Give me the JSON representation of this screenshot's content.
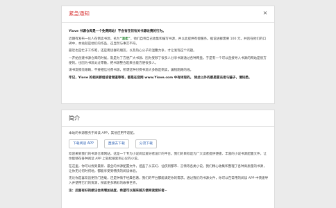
{
  "notice": {
    "title": "紧急通知",
    "close_symbol": "×",
    "paragraphs": [
      {
        "type": "strong",
        "text": "Yiove 书源仓库是一个免费网站！不会有任何有关书源收费的行为。"
      },
      {
        "type": "rich",
        "before": "近期有发布一伙人在倒卖书源，名为",
        "highlight": "“温柔”",
        "after": "，他们自称自己收集和编写书源，并以此提供有偿服务。据说进群需要 100 元，并且在他们的口碑中，本站就是他们的作品，这显然与事实不符。"
      },
      {
        "type": "normal",
        "text": "最近也是忙于工作吧，还是用读群的朋友，以及热心公子的温馨力争，才让发现这个问题。"
      },
      {
        "type": "normal",
        "text": "一开始创建书源仓库的时候，就是为了方便广大书源、因为受够了很多人分享书源通过各种网盘，于是有一个可以直接导入书源的网站是很方便的。也因为书源太过零散，把书源整合起来也能方便很多人。"
      },
      {
        "type": "normal",
        "text": "请书友擦亮眼睛，不要相信付费书源，所谓这种付费书源大多数是倒卖，骗钱跑路的线。"
      },
      {
        "type": "strong",
        "text": "牢记，Yiove 的相关群组或者频道等等，都是在官网 www.Yiove.com 中有体现的。 除此以外的都是冒充者与骗子，请知悉。"
      }
    ]
  },
  "intro": {
    "title": "简介",
    "lead": "本站的书源服务于阅读 APP，其他应用不适配。",
    "buttons": {
      "download": "下载阅读 APP",
      "github": "直接去下载",
      "share": "分流下载"
    },
    "paragraphs": [
      {
        "type": "normal",
        "text": "欢迎来到我们的书源仓库网站，这是一个专为小说阅读爱好者设计的平台。我们的目标是为广大读者提供便捷、丰富的小说书源配置文件，让你能够在各种阅读 APP 上轻松搜索到心仪的小说。"
      },
      {
        "type": "normal",
        "text": "在这里，你可以找到最新、最全的书源配置文件，涵盖了从玄幻、仙侠到都市、言情等各类小说。我们精心收集和整理了各种高质量的书源，让你无论何时何地，都能享受到畅快的阅读体验。"
      },
      {
        "type": "normal",
        "text": "无论你是喜欢追更热门连载，还是钟情于经典名著，我们的平台都能满足你的需求。通过我们的书源文件，你可以在常用的阅读 APP 中快速导入并使用它们的资源，探索更多精彩的故事世界。"
      },
      {
        "type": "strong",
        "text": "注：后面有好的想法会再增加进度，希望可以越来越方便阅读爱好者~"
      }
    ]
  }
}
